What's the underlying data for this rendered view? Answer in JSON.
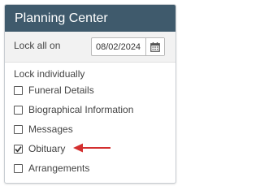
{
  "header": {
    "title": "Planning Center"
  },
  "lock_all": {
    "label": "Lock all on",
    "date_value": "08/02/2024",
    "calendar_icon": "calendar-icon"
  },
  "lock_individually": {
    "label": "Lock individually",
    "items": [
      {
        "label": "Funeral Details",
        "checked": false
      },
      {
        "label": "Biographical Information",
        "checked": false
      },
      {
        "label": "Messages",
        "checked": false
      },
      {
        "label": "Obituary",
        "checked": true
      },
      {
        "label": "Arrangements",
        "checked": false
      }
    ]
  },
  "annotation": {
    "icon": "red-arrow-icon",
    "color": "#d32f2f"
  },
  "colors": {
    "header_bg": "#3f5a6c",
    "header_text": "#ffffff",
    "lock_row_bg": "#f2f2f2"
  }
}
